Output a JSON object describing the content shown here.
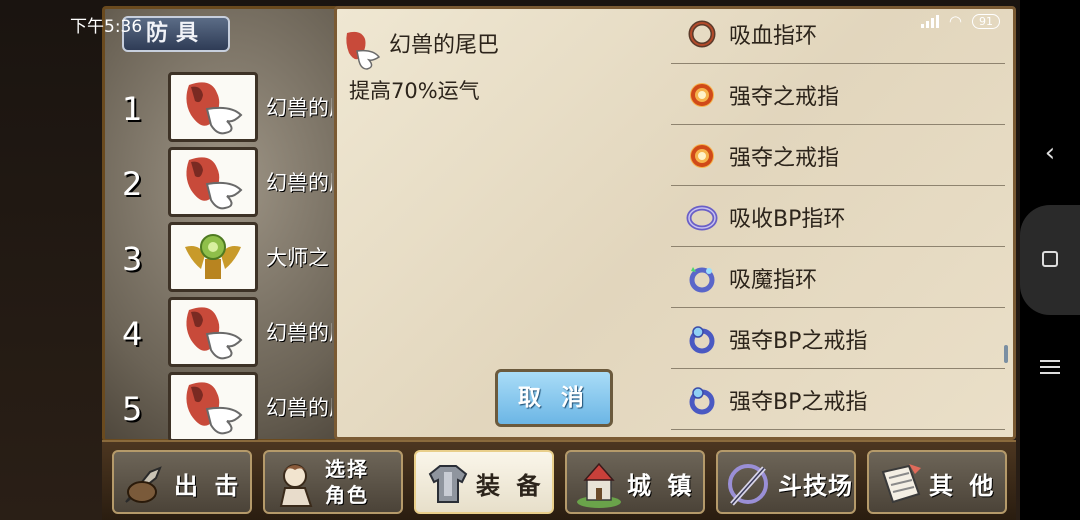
{
  "status_bar": {
    "time": "下午5:36",
    "battery": "91"
  },
  "panel_title": "防具",
  "slots": [
    {
      "num": "1",
      "name": "幻兽的尾巴",
      "icon": "fox-tail-icon"
    },
    {
      "num": "2",
      "name": "幻兽的尾巴",
      "icon": "fox-tail-icon"
    },
    {
      "num": "3",
      "name": "大师之",
      "icon": "golden-emblem-icon"
    },
    {
      "num": "4",
      "name": "幻兽的尾巴",
      "icon": "fox-tail-icon"
    },
    {
      "num": "5",
      "name": "幻兽的尾巴",
      "icon": "fox-tail-icon"
    }
  ],
  "item": {
    "title": "幻兽的尾巴",
    "description": "提高70%运气",
    "icon": "fox-tail-icon"
  },
  "cancel_label": "取 消",
  "rings": [
    {
      "label": "吸血指环",
      "color": "#b34a2a"
    },
    {
      "label": "强夺之戒指",
      "color": "#e07a23"
    },
    {
      "label": "强夺之戒指",
      "color": "#e07a23"
    },
    {
      "label": "吸收BP指环",
      "color": "#6a5fc7"
    },
    {
      "label": "吸魔指环",
      "color": "#5a66c9"
    },
    {
      "label": "强夺BP之戒指",
      "color": "#4a59c2"
    },
    {
      "label": "强夺BP之戒指",
      "color": "#4a59c2"
    }
  ],
  "nav": [
    {
      "label": "出 击",
      "icon": "sword-icon",
      "active": false
    },
    {
      "label": "选择\n角色",
      "icon": "character-icon",
      "active": false
    },
    {
      "label": "装 备",
      "icon": "armor-icon",
      "active": true
    },
    {
      "label": "城 镇",
      "icon": "castle-icon",
      "active": false
    },
    {
      "label": "斗技场",
      "icon": "arena-icon",
      "active": false
    },
    {
      "label": "其 他",
      "icon": "scroll-icon",
      "active": false
    }
  ]
}
